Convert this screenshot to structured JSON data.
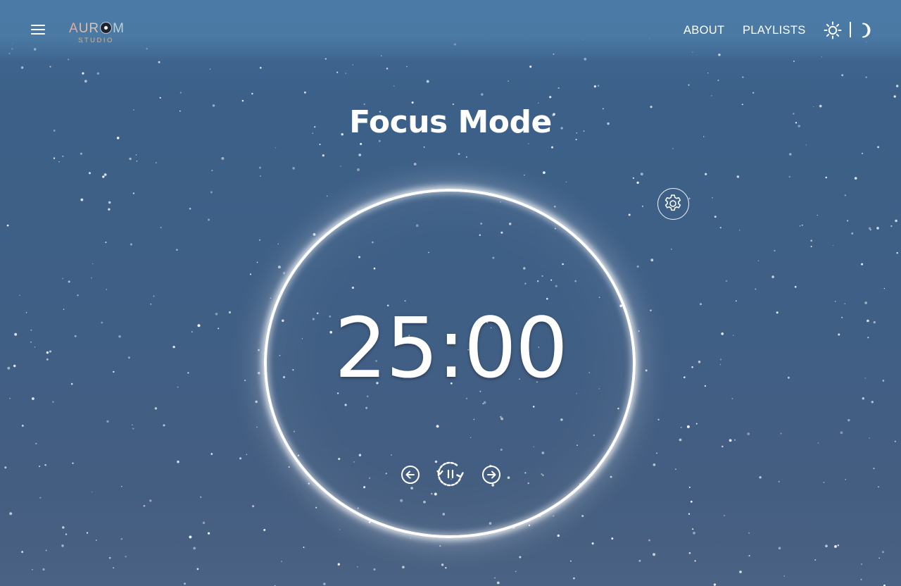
{
  "header": {
    "menu_icon": "hamburger-menu-icon",
    "logo": {
      "main_text": "AUROM",
      "sub_text": "STUDIO"
    },
    "nav": [
      {
        "label": "ABOUT"
      },
      {
        "label": "PLAYLISTS"
      }
    ],
    "theme_toggle": {
      "light_icon": "sun-icon",
      "dark_icon": "moon-icon"
    }
  },
  "main": {
    "title": "Focus Mode",
    "timer": "25:00",
    "settings_icon": "gear-icon",
    "controls": [
      {
        "icon": "arrow-left-circle-icon"
      },
      {
        "icon": "pause-restart-icon"
      },
      {
        "icon": "arrow-right-circle-icon"
      }
    ]
  },
  "colors": {
    "background_top": "#46719c",
    "background_bottom": "#4a6283",
    "ring": "#ffffff",
    "text": "#ffffff",
    "logo_sub": "#e2b072"
  }
}
